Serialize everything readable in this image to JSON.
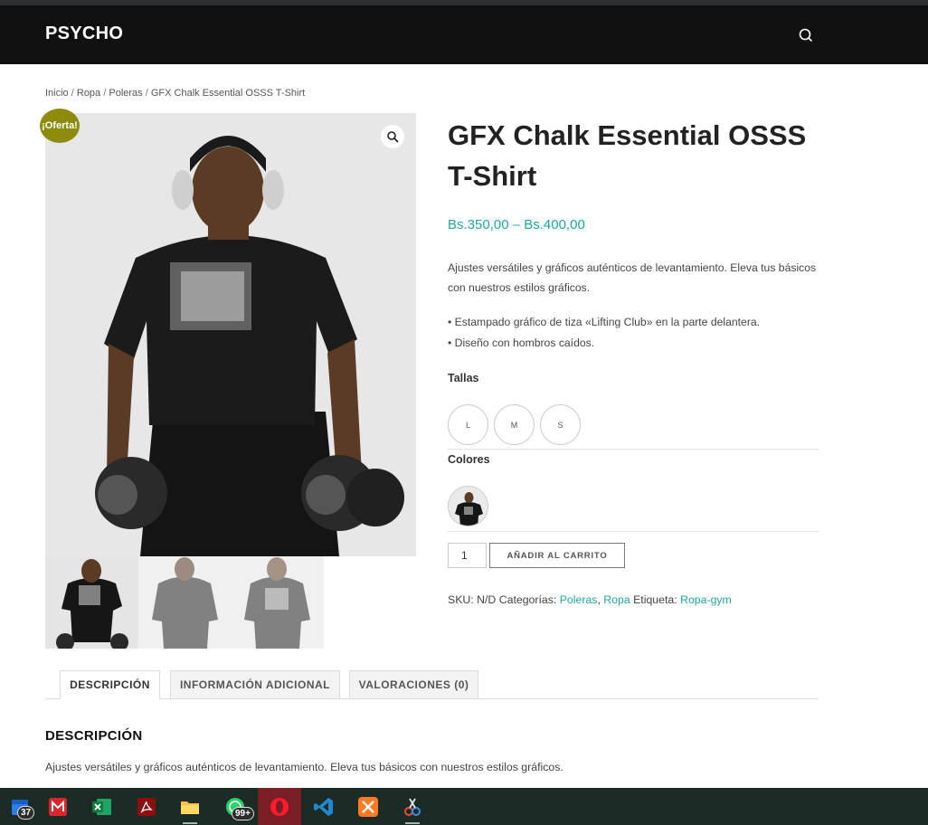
{
  "header": {
    "brand": "PSYCHO"
  },
  "breadcrumb": {
    "items": [
      "Inicio",
      "Ropa",
      "Poleras"
    ],
    "current": "GFX Chalk Essential OSSS T-Shirt",
    "separator": "/"
  },
  "gallery": {
    "sale_badge": "¡Oferta!"
  },
  "product": {
    "title": "GFX Chalk Essential OSSS T-Shirt",
    "price": "Bs.350,00 – Bs.400,00",
    "short_description": "Ajustes versátiles y gráficos auténticos de levantamiento. Eleva tus básicos con nuestros estilos gráficos.",
    "bullets": [
      "• Estampado gráfico de tiza «Lifting Club» en la parte delantera.",
      "• Diseño con hombros caídos."
    ],
    "sizes_label": "Tallas",
    "sizes": [
      "L",
      "M",
      "S"
    ],
    "colors_label": "Colores",
    "quantity": "1",
    "add_to_cart": "AÑADIR AL CARRITO",
    "meta": {
      "sku_label": "SKU:",
      "sku": "N/D",
      "categories_label": "Categorías:",
      "categories": [
        "Poleras",
        "Ropa"
      ],
      "tag_label": "Etiqueta:",
      "tag": "Ropa-gym"
    }
  },
  "tabs": [
    "DESCRIPCIÓN",
    "INFORMACIÓN ADICIONAL",
    "VALORACIONES (0)"
  ],
  "description_section": {
    "title": "DESCRIPCIÓN",
    "text": "Ajustes versátiles y gráficos auténticos de levantamiento. Eleva tus básicos con nuestros estilos gráficos."
  },
  "taskbar": {
    "badges": {
      "calendar": "37",
      "whatsapp": "99+"
    },
    "apps": [
      "calendar-icon",
      "mega-icon",
      "excel-icon",
      "acrobat-icon",
      "file-explorer-icon",
      "whatsapp-icon",
      "opera-icon",
      "vscode-icon",
      "xampp-icon",
      "snipping-tool-icon"
    ]
  },
  "colors": {
    "accent": "#1fa79b",
    "header_bg": "#111111",
    "sale_badge": "#8d8a0c",
    "taskbar_bg": "#1c2b26"
  }
}
